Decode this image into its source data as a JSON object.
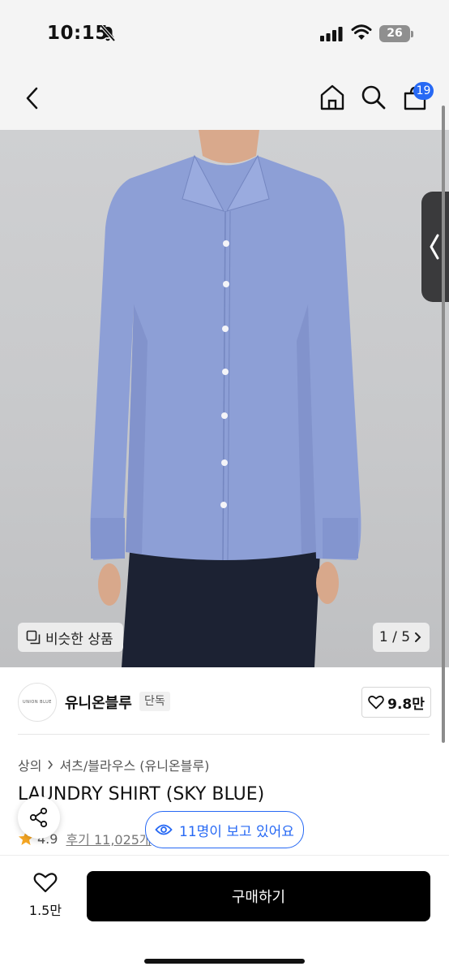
{
  "status_bar": {
    "time": "10:15",
    "battery": "26"
  },
  "header": {
    "cart_count": "19"
  },
  "product_image": {
    "similar_label": "비슷한 상품",
    "pager": "1 / 5"
  },
  "brand": {
    "logo_text": "UNION BLUE",
    "name": "유니온블루",
    "tag": "단독",
    "likes": "9.8만"
  },
  "breadcrumb": {
    "level1": "상의",
    "level2": "셔츠/블라우스 (유니온블루)"
  },
  "product": {
    "title": "LAUNDRY SHIRT (SKY BLUE)",
    "rating": "4.9",
    "reviews": "후기 11,025개"
  },
  "viewers_pill": "11명이 보고 있어요",
  "bottom_bar": {
    "wish_count": "1.5만",
    "buy_label": "구매하기"
  },
  "colors": {
    "accent": "#2769f4",
    "buy_button": "#000000",
    "shirt": "#8d9fd6"
  }
}
